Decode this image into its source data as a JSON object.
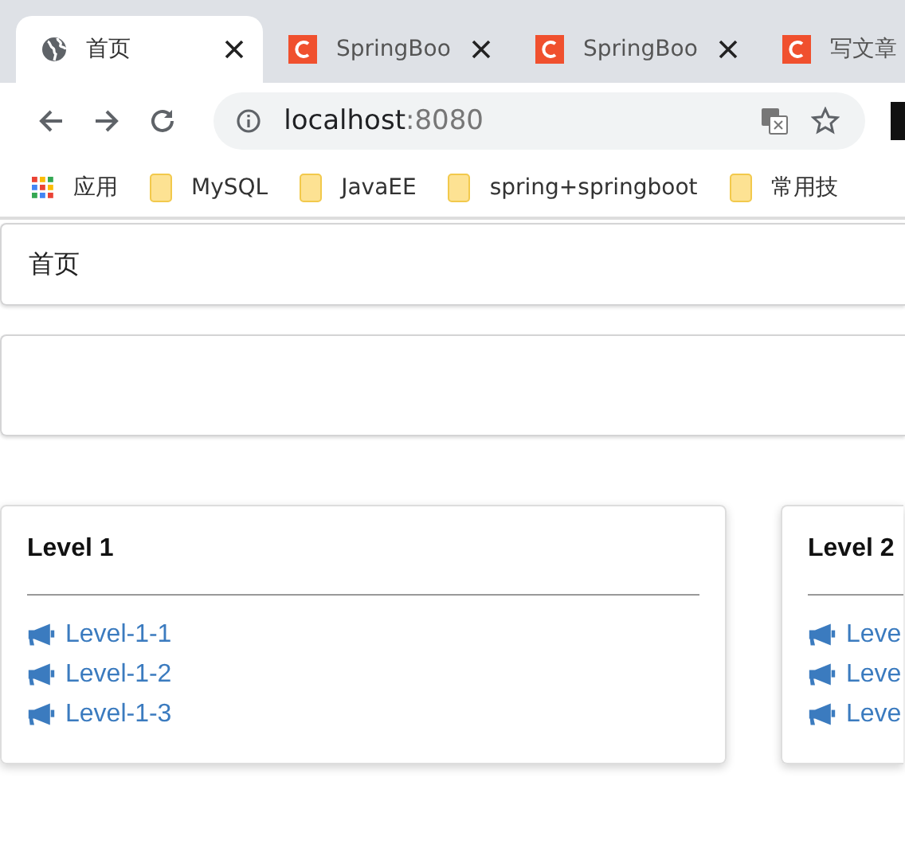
{
  "browser": {
    "tabs": [
      {
        "title": "首页",
        "kind": "globe",
        "selected": true
      },
      {
        "title": "SpringBoo",
        "kind": "csdn",
        "selected": false
      },
      {
        "title": "SpringBoo",
        "kind": "csdn",
        "selected": false
      },
      {
        "title": "写文章",
        "kind": "csdn",
        "selected": false
      }
    ],
    "address": {
      "host": "localhost",
      "port": ":8080"
    },
    "bookmarks": [
      {
        "label": "应用",
        "kind": "apps"
      },
      {
        "label": "MySQL",
        "kind": "folder"
      },
      {
        "label": "JavaEE",
        "kind": "folder"
      },
      {
        "label": "spring+springboot",
        "kind": "folder"
      },
      {
        "label": "常用技",
        "kind": "folder"
      }
    ]
  },
  "page": {
    "header": "首页",
    "cards": [
      {
        "title": "Level 1",
        "items": [
          "Level-1-1",
          "Level-1-2",
          "Level-1-3"
        ]
      },
      {
        "title": "Level 2",
        "items": [
          "Leve",
          "Leve",
          "Leve"
        ]
      }
    ]
  }
}
